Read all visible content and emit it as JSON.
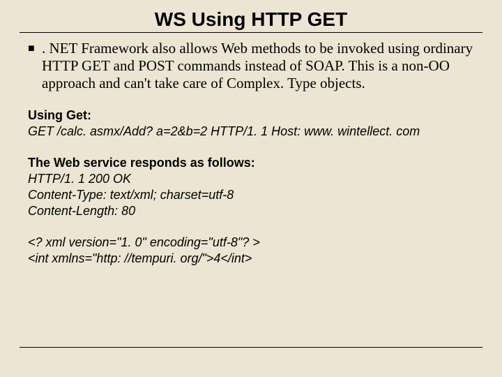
{
  "title": "WS Using HTTP GET",
  "bullet": ". NET Framework also allows Web methods to be invoked using ordinary HTTP GET and POST commands instead of SOAP. This is a non-OO approach and can't take care of Complex. Type objects.",
  "sections": {
    "get_heading": "Using Get:",
    "get_line": "GET /calc. asmx/Add? a=2&b=2 HTTP/1. 1 Host: www. wintellect. com",
    "resp_heading": "The Web service responds as follows:",
    "resp_line1": "HTTP/1. 1 200 OK",
    "resp_line2": "Content-Type: text/xml; charset=utf-8",
    "resp_line3": "Content-Length: 80",
    "xml_line1": "<? xml version=\"1. 0\" encoding=\"utf-8\"? >",
    "xml_line2": "<int xmlns=\"http: //tempuri. org/\">4</int>"
  }
}
